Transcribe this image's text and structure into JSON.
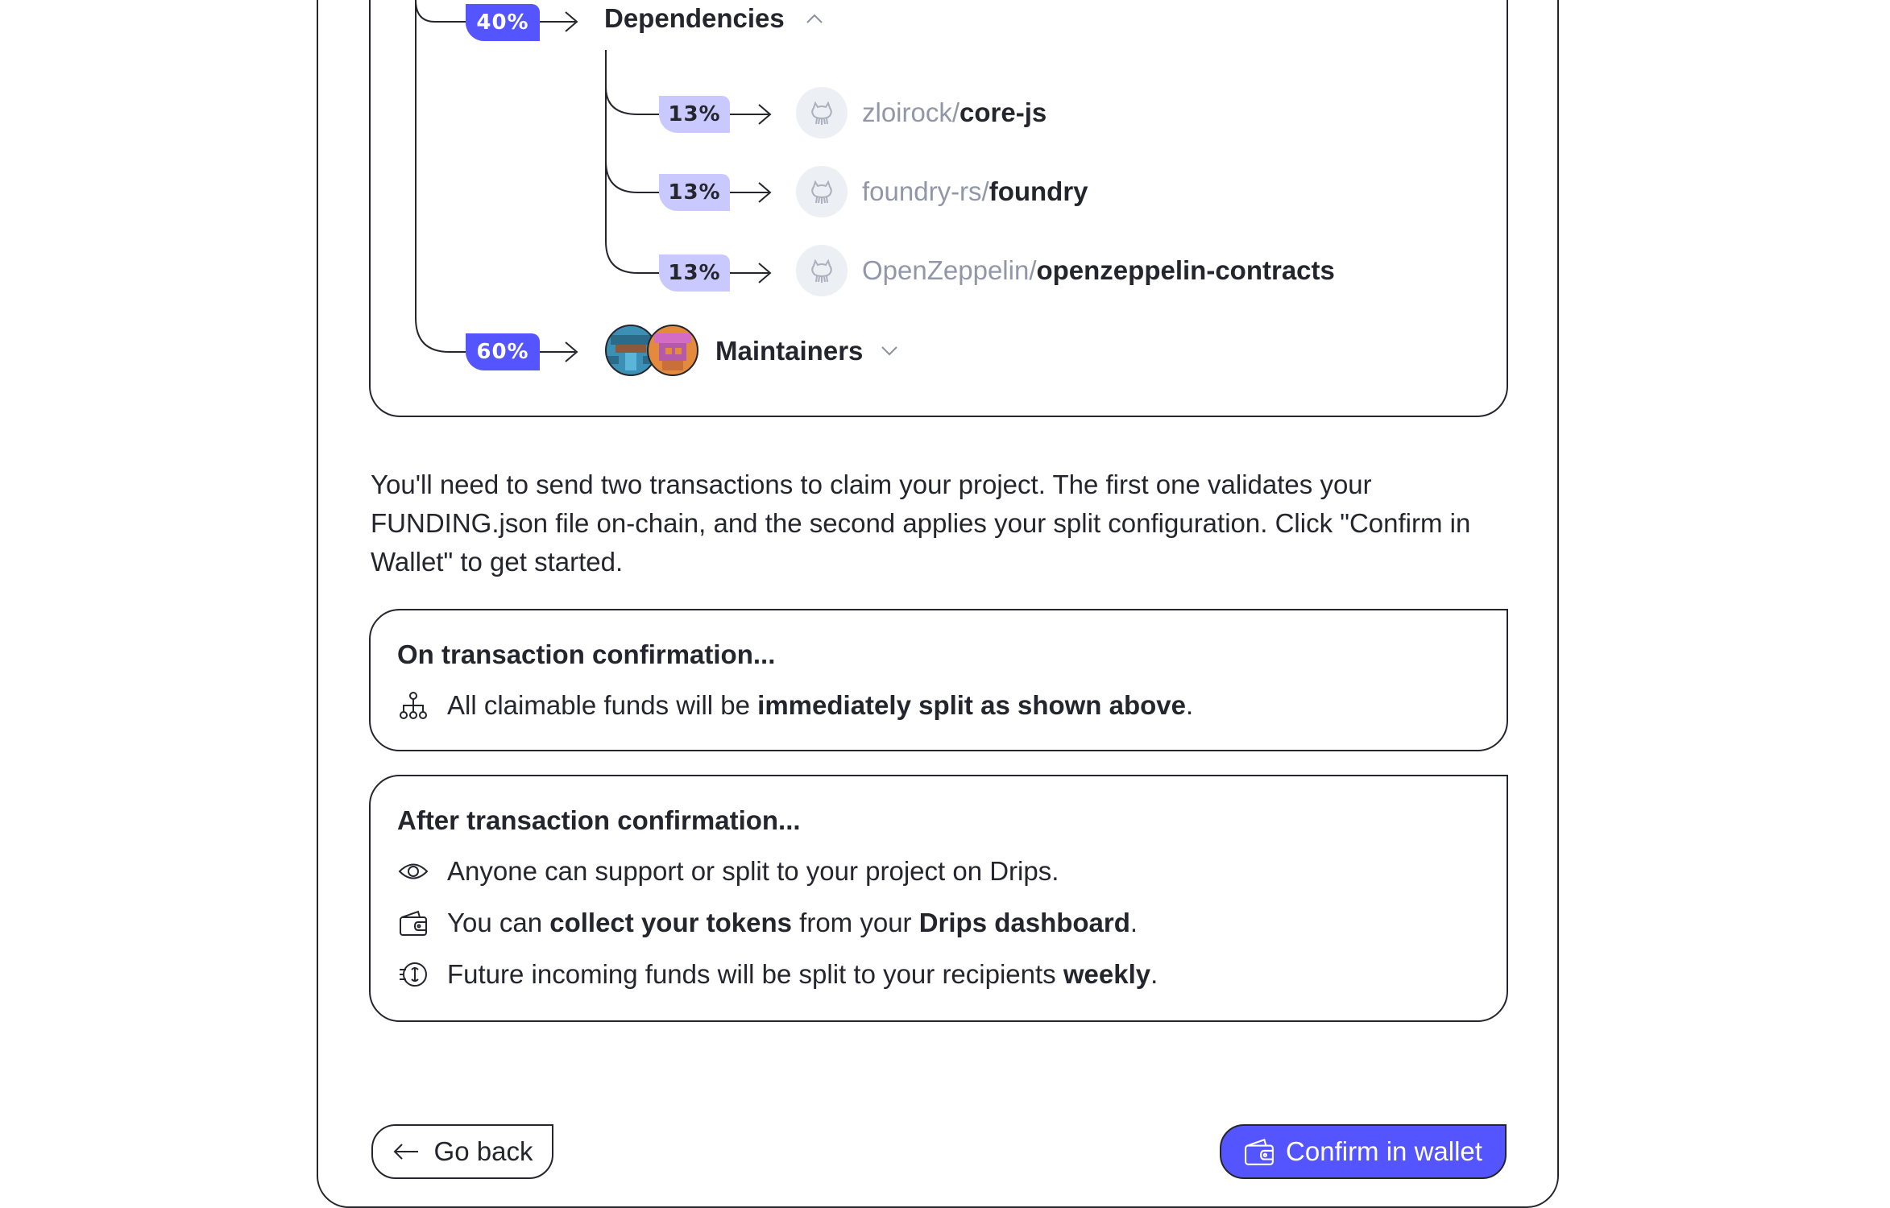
{
  "tree": {
    "dependencies": {
      "percent": "40%",
      "label": "Dependencies",
      "items": [
        {
          "percent": "13%",
          "owner": "zloirock/",
          "name": "core-js"
        },
        {
          "percent": "13%",
          "owner": "foundry-rs/",
          "name": "foundry"
        },
        {
          "percent": "13%",
          "owner": "OpenZeppelin/",
          "name": "openzeppelin-contracts"
        }
      ]
    },
    "maintainers": {
      "percent": "60%",
      "label": "Maintainers"
    }
  },
  "info": {
    "text": "You'll need to send two transactions to claim your project. The first one validates your FUNDING.json file on-chain, and the second applies your split configuration. Click \"Confirm in Wallet\" to get started."
  },
  "on_confirm": {
    "title": "On transaction confirmation...",
    "row1": {
      "pre": "All claimable funds will be ",
      "bold": "immediately split as shown above",
      "post": "."
    }
  },
  "after_confirm": {
    "title": "After transaction confirmation...",
    "row1": {
      "text": "Anyone can support or split to your project on Drips."
    },
    "row2": {
      "pre": "You can ",
      "bold1": "collect your tokens",
      "mid": " from your ",
      "bold2": "Drips dashboard",
      "post": "."
    },
    "row3": {
      "pre": "Future incoming funds will be split to your recipients ",
      "bold": "weekly",
      "post": "."
    }
  },
  "buttons": {
    "back": "Go back",
    "confirm": "Confirm in wallet"
  },
  "colors": {
    "accent": "#5555ff",
    "accent_soft": "#c9c9ff",
    "text": "#24252d",
    "muted": "#9197a8"
  }
}
